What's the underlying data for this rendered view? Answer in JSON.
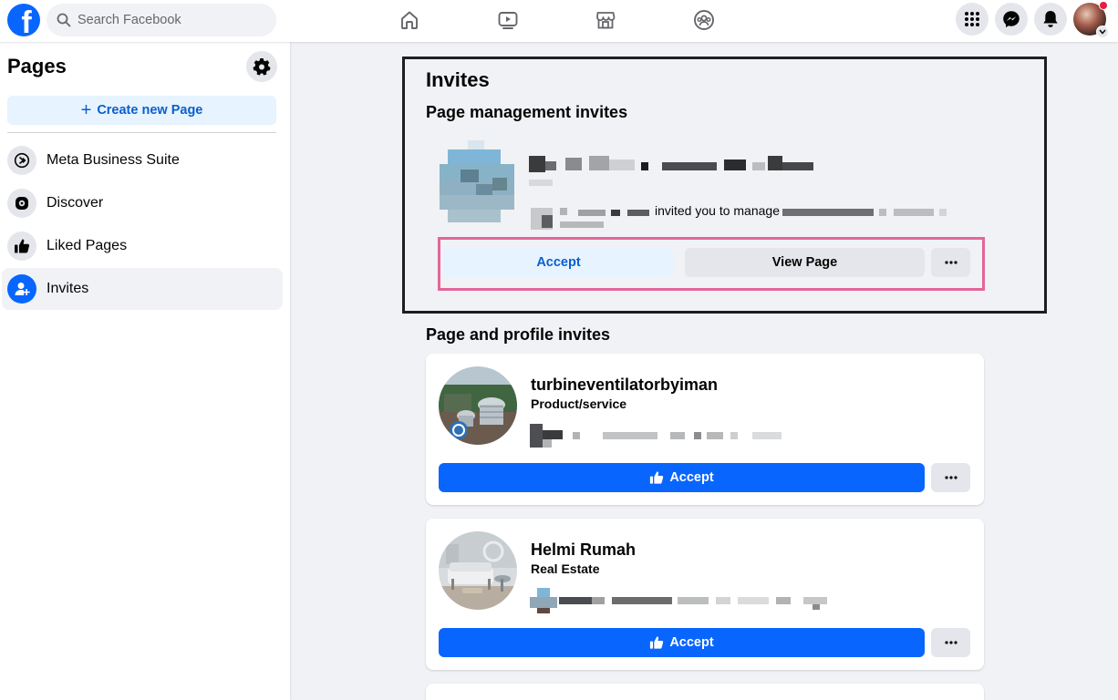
{
  "topbar": {
    "search_placeholder": "Search Facebook",
    "logo_letter": "f"
  },
  "sidebar": {
    "title": "Pages",
    "create_label": "Create new Page",
    "items": [
      {
        "label": "Meta Business Suite",
        "icon": "meta-business-suite-icon"
      },
      {
        "label": "Discover",
        "icon": "compass-icon"
      },
      {
        "label": "Liked Pages",
        "icon": "thumbs-up-icon"
      },
      {
        "label": "Invites",
        "icon": "person-add-icon",
        "active": true
      }
    ]
  },
  "main": {
    "invites_title": "Invites",
    "page_management": {
      "title": "Page management invites",
      "invite_text": "invited you to manage",
      "accept_label": "Accept",
      "view_page_label": "View Page",
      "more_label": "···"
    },
    "page_profile": {
      "title": "Page and profile invites",
      "cards": [
        {
          "name": "turbineventilatorbyiman",
          "category": "Product/service",
          "accept_label": "Accept",
          "more_label": "···"
        },
        {
          "name": "Helmi Rumah",
          "category": "Real Estate",
          "accept_label": "Accept",
          "more_label": "···"
        }
      ]
    }
  },
  "colors": {
    "brand": "#0866ff",
    "accent_light": "#e7f3ff",
    "highlight_outline": "#e26699",
    "dark_outline": "#1c1e21"
  }
}
